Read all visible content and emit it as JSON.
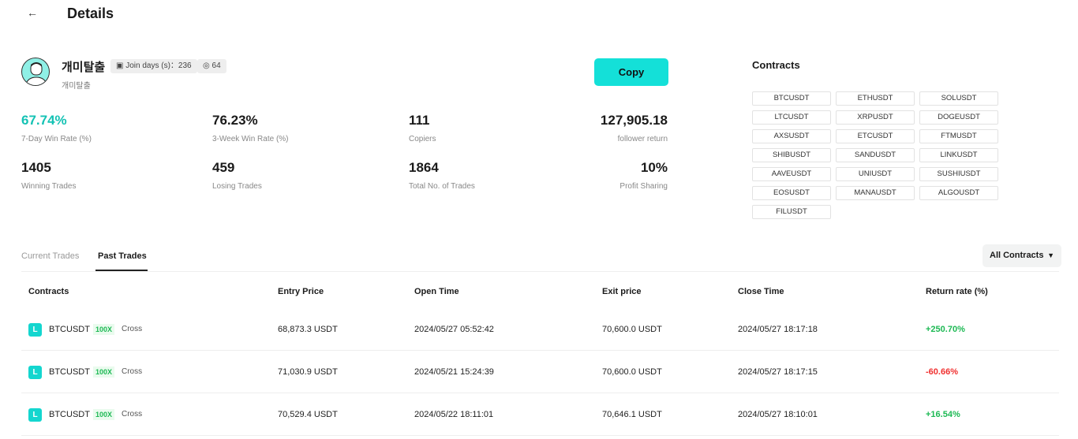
{
  "header": {
    "back_icon": "←",
    "title": "Details"
  },
  "profile": {
    "name": "개미탈출",
    "sub": "개미탈출",
    "join_label": "Join days (s)：236",
    "followers": "64",
    "copy": "Copy"
  },
  "stats": [
    {
      "value": "67.74%",
      "label": "7-Day Win Rate (%)",
      "color": "#14c2b4"
    },
    {
      "value": "76.23%",
      "label": "3-Week Win Rate (%)"
    },
    {
      "value": "111",
      "label": "Copiers"
    },
    {
      "value": "127,905.18",
      "label": "follower return"
    },
    {
      "value": "1405",
      "label": "Winning Trades"
    },
    {
      "value": "459",
      "label": "Losing Trades"
    },
    {
      "value": "1864",
      "label": "Total No. of Trades"
    },
    {
      "value": "10%",
      "label": "Profit Sharing"
    }
  ],
  "contracts": {
    "title": "Contracts",
    "items": [
      "BTCUSDT",
      "ETHUSDT",
      "SOLUSDT",
      "LTCUSDT",
      "XRPUSDT",
      "DOGEUSDT",
      "AXSUSDT",
      "ETCUSDT",
      "FTMUSDT",
      "SHIBUSDT",
      "SANDUSDT",
      "LINKUSDT",
      "AAVEUSDT",
      "UNIUSDT",
      "SUSHIUSDT",
      "EOSUSDT",
      "MANAUSDT",
      "ALGOUSDT",
      "FILUSDT"
    ]
  },
  "tabs": [
    "Current Trades",
    "Past Trades"
  ],
  "filter": "All Contracts",
  "table": {
    "headers": [
      "Contracts",
      "Entry Price",
      "Open Time",
      "Exit price",
      "Close Time",
      "Return rate (%)"
    ],
    "rows": [
      {
        "side": "L",
        "symbol": "BTCUSDT",
        "leverage": "100X",
        "mode": "Cross",
        "entry": "68,873.3 USDT",
        "open": "2024/05/27 05:52:42",
        "exit": "70,600.0 USDT",
        "close": "2024/05/27 18:17:18",
        "ret": "+250.70%"
      },
      {
        "side": "L",
        "symbol": "BTCUSDT",
        "leverage": "100X",
        "mode": "Cross",
        "entry": "71,030.9 USDT",
        "open": "2024/05/21 15:24:39",
        "exit": "70,600.0 USDT",
        "close": "2024/05/27 18:17:15",
        "ret": "-60.66%"
      },
      {
        "side": "L",
        "symbol": "BTCUSDT",
        "leverage": "100X",
        "mode": "Cross",
        "entry": "70,529.4 USDT",
        "open": "2024/05/22 18:11:01",
        "exit": "70,646.1 USDT",
        "close": "2024/05/27 18:10:01",
        "ret": "+16.54%"
      }
    ]
  },
  "colors": {
    "accent": "#14e0d8",
    "positive": "#1db954",
    "negative": "#f0302f"
  }
}
